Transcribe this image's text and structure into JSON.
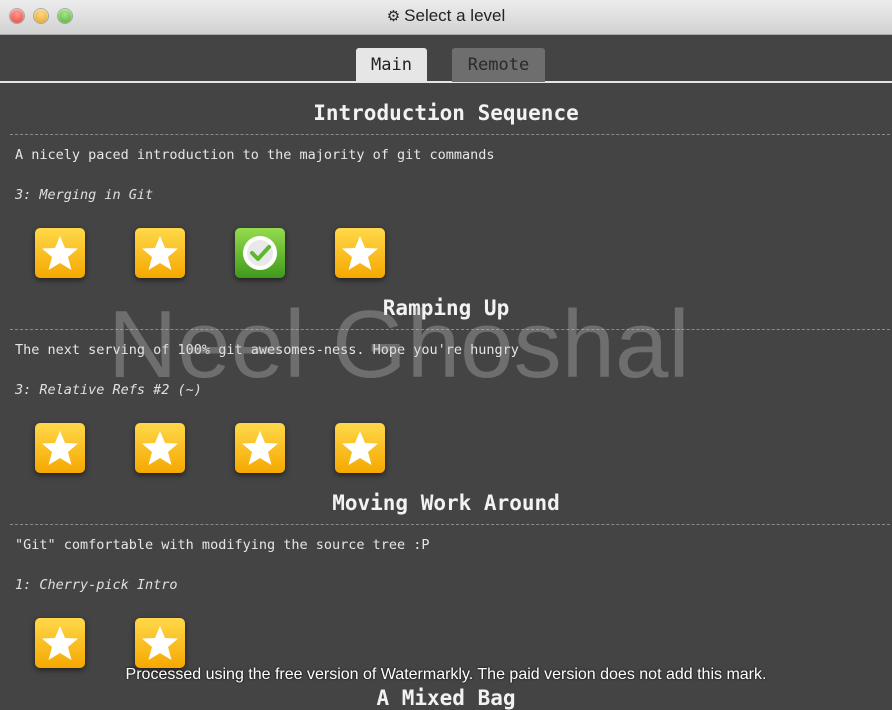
{
  "window": {
    "title": "Select a level",
    "title_icon": "gear-icon"
  },
  "tabs": [
    {
      "label": "Main",
      "active": true
    },
    {
      "label": "Remote",
      "active": false
    }
  ],
  "sections": [
    {
      "title": "Introduction Sequence",
      "description": "A nicely paced introduction to the majority of git commands",
      "current_level": "3: Merging in Git",
      "levels": [
        "star",
        "star",
        "completed",
        "star"
      ]
    },
    {
      "title": "Ramping Up",
      "description": "The next serving of 100% git awesomes-ness. Hope you're hungry",
      "current_level": "3: Relative Refs #2 (~)",
      "levels": [
        "star",
        "star",
        "star",
        "star"
      ]
    },
    {
      "title": "Moving Work Around",
      "description": "\"Git\" comfortable with modifying the source tree :P",
      "current_level": "1: Cherry-pick Intro",
      "levels": [
        "star",
        "star"
      ]
    },
    {
      "title": "A Mixed Bag"
    }
  ],
  "watermark": {
    "text": "Neel Ghoshal",
    "notice": "Processed using the free version of Watermarkly. The paid version does not add this mark."
  },
  "colors": {
    "background": "#444444",
    "star_tile": "#f5b800",
    "completed_tile": "#5cb82d",
    "tab_active": "#e6e6e6",
    "tab_inactive": "#6e6e6e"
  }
}
